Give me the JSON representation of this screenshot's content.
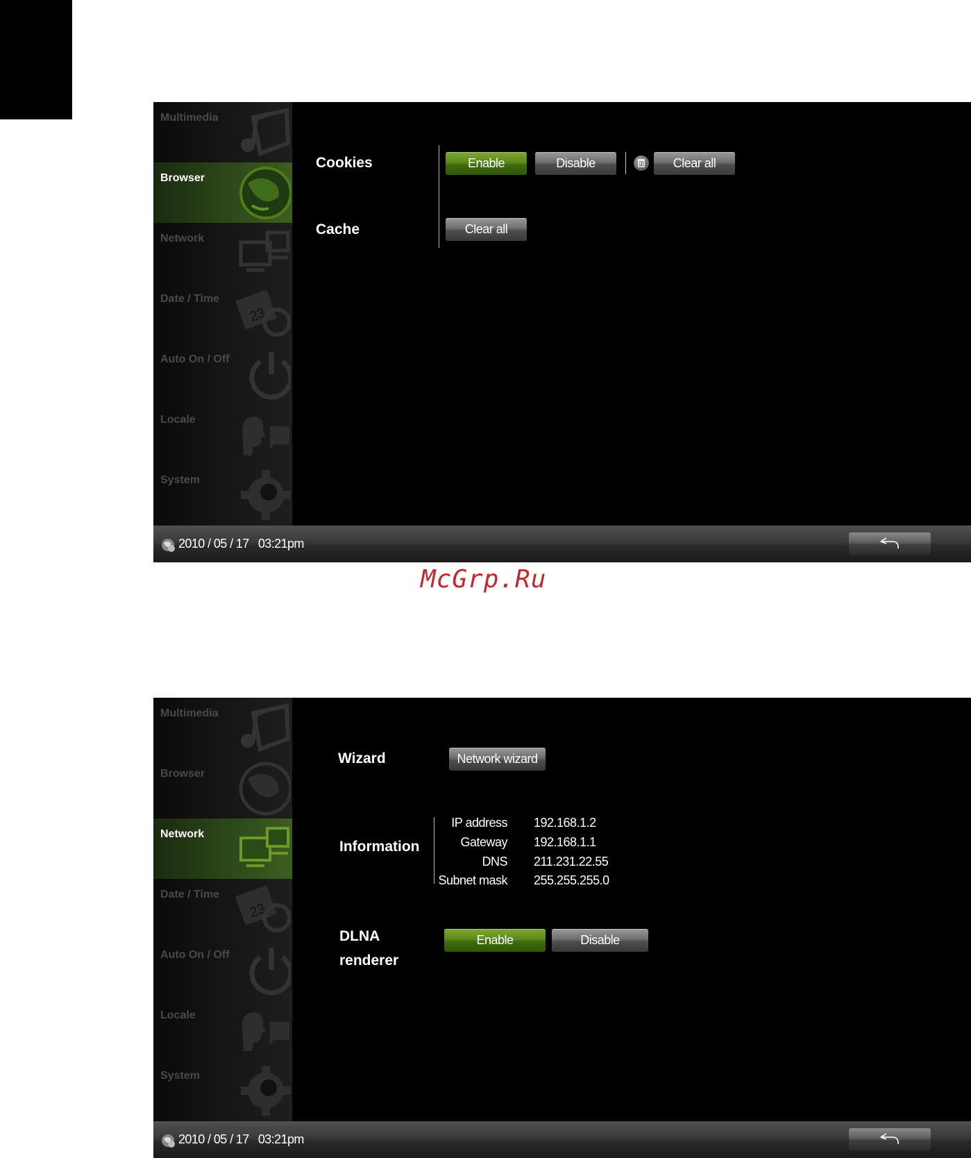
{
  "sidebar": {
    "items": [
      {
        "label": "Multimedia",
        "icon": "multimedia-icon"
      },
      {
        "label": "Browser",
        "icon": "globe-icon"
      },
      {
        "label": "Network",
        "icon": "network-icon"
      },
      {
        "label": "Date / Time",
        "icon": "calendar-clock-icon"
      },
      {
        "label": "Auto On / Off",
        "icon": "power-icon"
      },
      {
        "label": "Locale",
        "icon": "speech-icon"
      },
      {
        "label": "System",
        "icon": "gear-icon"
      }
    ]
  },
  "screen1": {
    "active_item": "Browser",
    "cookies": {
      "label": "Cookies",
      "enable": "Enable",
      "disable": "Disable",
      "clear_all": "Clear all",
      "state": "enabled"
    },
    "cache": {
      "label": "Cache",
      "clear_all": "Clear all"
    }
  },
  "screen2": {
    "active_item": "Network",
    "wizard": {
      "label": "Wizard",
      "button": "Network wizard"
    },
    "information": {
      "label": "Information",
      "rows": [
        {
          "key": "IP address",
          "value": "192.168.1.2"
        },
        {
          "key": "Gateway",
          "value": "192.168.1.1"
        },
        {
          "key": "DNS",
          "value": "211.231.22.55"
        },
        {
          "key": "Subnet mask",
          "value": "255.255.255.0"
        }
      ]
    },
    "dlna": {
      "label_line1": "DLNA",
      "label_line2": "renderer",
      "enable": "Enable",
      "disable": "Disable",
      "state": "enabled"
    }
  },
  "statusbar": {
    "datetime": "2010 / 05 / 17   03:21pm"
  },
  "watermark": "McGrp.Ru",
  "colors": {
    "accent_green": "#4f7d16",
    "background": "#000000"
  }
}
